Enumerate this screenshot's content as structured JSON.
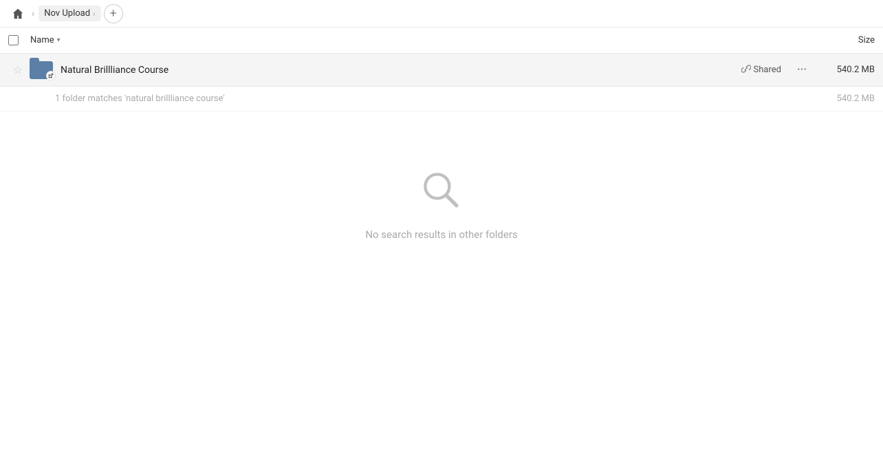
{
  "breadcrumb": {
    "home_label": "Home",
    "items": [
      {
        "label": "Nov Upload",
        "id": "nov-upload"
      }
    ],
    "add_label": "+"
  },
  "columns": {
    "name_label": "Name",
    "size_label": "Size"
  },
  "file_row": {
    "name": "Natural Brillliance Course",
    "shared_label": "Shared",
    "size": "540.2 MB",
    "more_label": "···"
  },
  "summary": {
    "text": "1 folder matches 'natural brillliance course'",
    "size": "540.2 MB"
  },
  "empty_state": {
    "text": "No search results in other folders"
  },
  "colors": {
    "folder_blue": "#5b7fa6",
    "accent": "#4a90d9"
  }
}
